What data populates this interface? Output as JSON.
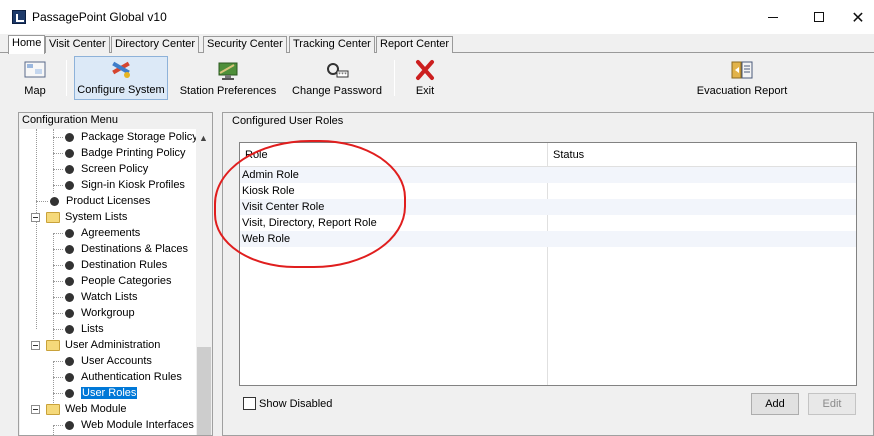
{
  "window": {
    "title": "PassagePoint Global v10"
  },
  "tabs": [
    {
      "label": "Home"
    },
    {
      "label": "Visit Center"
    },
    {
      "label": "Directory Center"
    },
    {
      "label": "Security Center"
    },
    {
      "label": "Tracking Center"
    },
    {
      "label": "Report Center"
    }
  ],
  "toolbar": {
    "map": "Map",
    "configure": "Configure System",
    "station": "Station Preferences",
    "password": "Change Password",
    "exit": "Exit",
    "evac": "Evacuation Report"
  },
  "config_menu": {
    "title": "Configuration Menu",
    "items": [
      {
        "label": "Package Storage Policy"
      },
      {
        "label": "Badge Printing Policy"
      },
      {
        "label": "Screen Policy"
      },
      {
        "label": "Sign-in Kiosk Profiles"
      },
      {
        "label": "Product Licenses"
      },
      {
        "label": "System Lists"
      },
      {
        "label": "Agreements"
      },
      {
        "label": "Destinations & Places"
      },
      {
        "label": "Destination Rules"
      },
      {
        "label": "People Categories"
      },
      {
        "label": "Watch Lists"
      },
      {
        "label": "Workgroup"
      },
      {
        "label": "Lists"
      },
      {
        "label": "User Administration"
      },
      {
        "label": "User Accounts"
      },
      {
        "label": "Authentication Rules"
      },
      {
        "label": "User Roles"
      },
      {
        "label": "Web Module"
      },
      {
        "label": "Web Module Interfaces"
      }
    ]
  },
  "roles_panel": {
    "title": "Configured User Roles",
    "columns": {
      "role": "Role",
      "status": "Status"
    },
    "rows": [
      {
        "role": "Admin Role",
        "status": ""
      },
      {
        "role": "Kiosk Role",
        "status": ""
      },
      {
        "role": "Visit Center Role",
        "status": ""
      },
      {
        "role": "Visit, Directory, Report Role",
        "status": ""
      },
      {
        "role": "Web Role",
        "status": ""
      }
    ],
    "show_disabled": "Show Disabled",
    "add": "Add",
    "edit": "Edit"
  },
  "colors": {
    "selection": "#0078d7",
    "annotation": "#e01e1e",
    "toolbar_selected": "#dce9f7"
  }
}
